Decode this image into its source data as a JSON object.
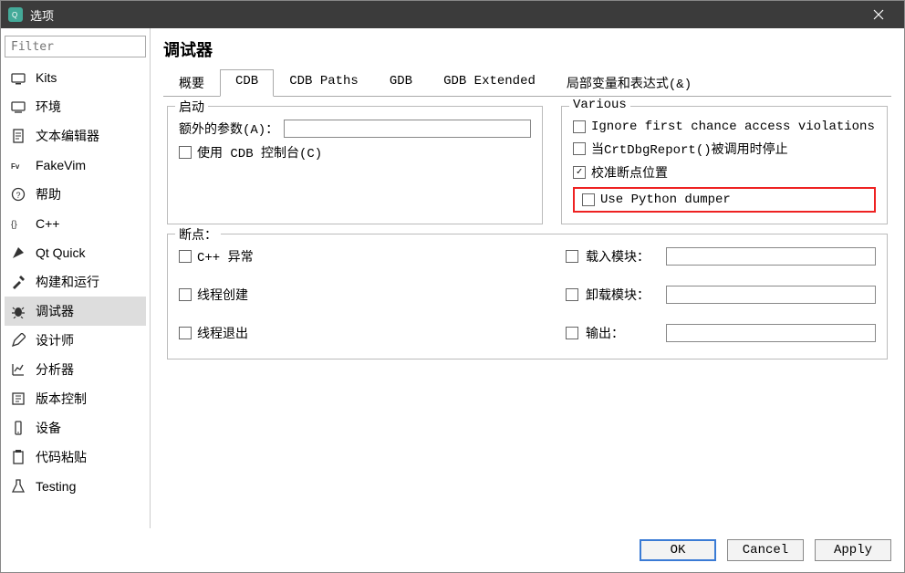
{
  "window": {
    "title": "选项"
  },
  "filter": {
    "placeholder": "Filter"
  },
  "categories": [
    {
      "id": "kits",
      "label": "Kits"
    },
    {
      "id": "env",
      "label": "环境"
    },
    {
      "id": "texteditor",
      "label": "文本编辑器"
    },
    {
      "id": "fakevim",
      "label": "FakeVim"
    },
    {
      "id": "help",
      "label": "帮助"
    },
    {
      "id": "cpp",
      "label": "C++"
    },
    {
      "id": "qtquick",
      "label": "Qt Quick"
    },
    {
      "id": "build",
      "label": "构建和运行"
    },
    {
      "id": "debugger",
      "label": "调试器",
      "selected": true
    },
    {
      "id": "designer",
      "label": "设计师"
    },
    {
      "id": "analyzer",
      "label": "分析器"
    },
    {
      "id": "vcs",
      "label": "版本控制"
    },
    {
      "id": "devices",
      "label": "设备"
    },
    {
      "id": "paste",
      "label": "代码粘贴"
    },
    {
      "id": "testing",
      "label": "Testing"
    }
  ],
  "page": {
    "title": "调试器"
  },
  "tabs": [
    {
      "id": "summary",
      "label": "概要"
    },
    {
      "id": "cdb",
      "label": "CDB",
      "active": true
    },
    {
      "id": "cdbpaths",
      "label": "CDB Paths"
    },
    {
      "id": "gdb",
      "label": "GDB"
    },
    {
      "id": "gdbext",
      "label": "GDB Extended"
    },
    {
      "id": "locals",
      "label": "局部变量和表达式(&)"
    }
  ],
  "cdb": {
    "startup": {
      "legend": "启动",
      "extraArgsLabel": "额外的参数(A)：",
      "useConsoleLabel": "使用 CDB 控制台(C)"
    },
    "various": {
      "legend": "Various",
      "ignoreFirst": "Ignore first chance access violations",
      "crtDbg": "当CrtDbgReport()被调用时停止",
      "correctBp": "校准断点位置",
      "pyDumper": "Use Python dumper"
    },
    "breakpoints": {
      "legend": "断点：",
      "cppEx": "C++ 异常",
      "threadCreate": "线程创建",
      "threadExit": "线程退出",
      "loadModule": "载入模块：",
      "unloadModule": "卸载模块：",
      "output": "输出："
    }
  },
  "buttons": {
    "ok": "OK",
    "cancel": "Cancel",
    "apply": "Apply"
  }
}
